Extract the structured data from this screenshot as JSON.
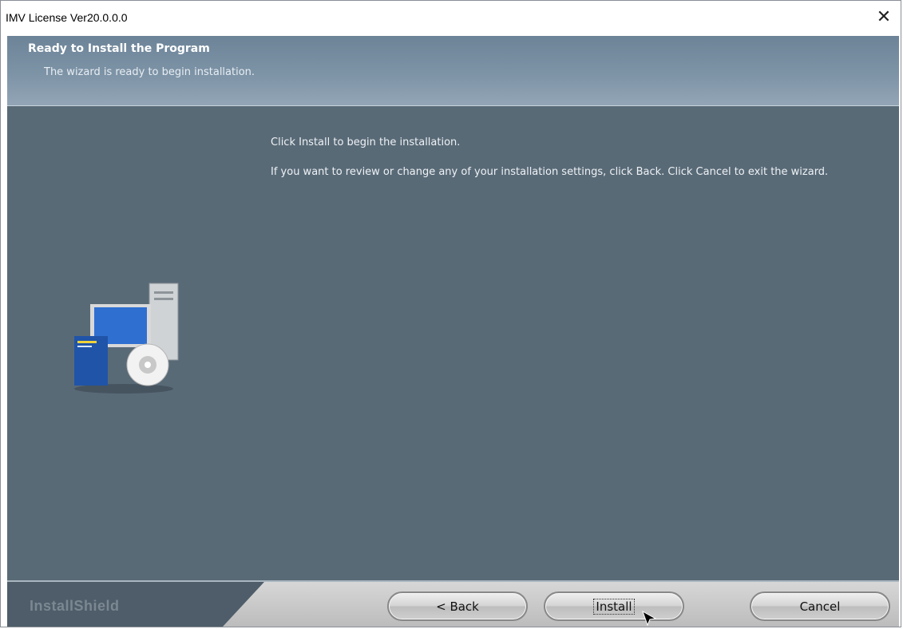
{
  "window": {
    "title": "IMV License Ver20.0.0.0",
    "close_glyph": "✕"
  },
  "header": {
    "title": "Ready to Install the Program",
    "subtitle": "The wizard is ready to begin installation."
  },
  "main": {
    "line1": "Click Install to begin the installation.",
    "line2": "If you want to review or change any of your installation settings, click Back. Click Cancel to exit the wizard."
  },
  "footer": {
    "brand": "InstallShield",
    "back_label": "< Back",
    "install_label": "Install",
    "cancel_label": "Cancel"
  },
  "icons": [
    "computer-setup-icon",
    "close-icon",
    "mouse-cursor-icon"
  ],
  "colors": {
    "main_bg": "#596a77",
    "header_bg": "#7d93a6",
    "footer_bg": "#4e5d69"
  }
}
